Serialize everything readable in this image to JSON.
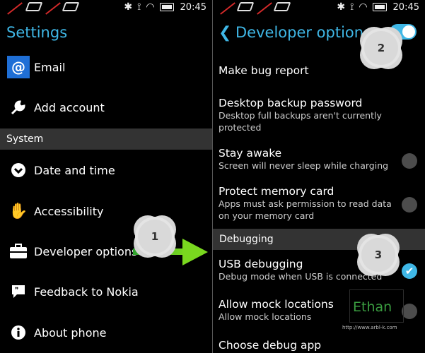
{
  "left": {
    "status": {
      "time": "20:45"
    },
    "title": "Settings",
    "items": [
      {
        "label": "Email",
        "icon": "at-icon"
      },
      {
        "label": "Add account",
        "icon": "wrench-icon"
      },
      {
        "label": "Date and time",
        "icon": "clock-icon"
      },
      {
        "label": "Accessibility",
        "icon": "hand-icon"
      },
      {
        "label": "Developer options",
        "icon": "briefcase-icon"
      },
      {
        "label": "Feedback to Nokia",
        "icon": "speech-bubble-icon"
      },
      {
        "label": "About phone",
        "icon": "info-icon"
      }
    ],
    "section": "System",
    "email_glyph": "@"
  },
  "right": {
    "status": {
      "time": "20:45"
    },
    "title": "Developer options",
    "master_toggle_on": true,
    "items": [
      {
        "main": "Make bug report"
      },
      {
        "main": "Desktop backup password",
        "sub": "Desktop full backups aren't currently protected"
      },
      {
        "main": "Stay awake",
        "sub": "Screen will never sleep while charging",
        "checked": false
      },
      {
        "main": "Protect memory card",
        "sub": "Apps must ask permission to read data on your memory card",
        "checked": false
      },
      {
        "main": "USB debugging",
        "sub": "Debug mode when USB is connected",
        "checked": true
      },
      {
        "main": "Allow mock locations",
        "sub": "Allow mock locations",
        "checked": false
      },
      {
        "main": "Choose debug app"
      }
    ],
    "section": "Debugging"
  },
  "annotations": {
    "badge1": "1",
    "badge2": "2",
    "badge3": "3",
    "check_glyph": "✔"
  },
  "watermark": {
    "name": "Ethan",
    "url": "http://www.arbl-k.com"
  },
  "colors": {
    "accent": "#3fb7e6",
    "section_bg": "#333333",
    "arrow": "#7ad81f"
  }
}
